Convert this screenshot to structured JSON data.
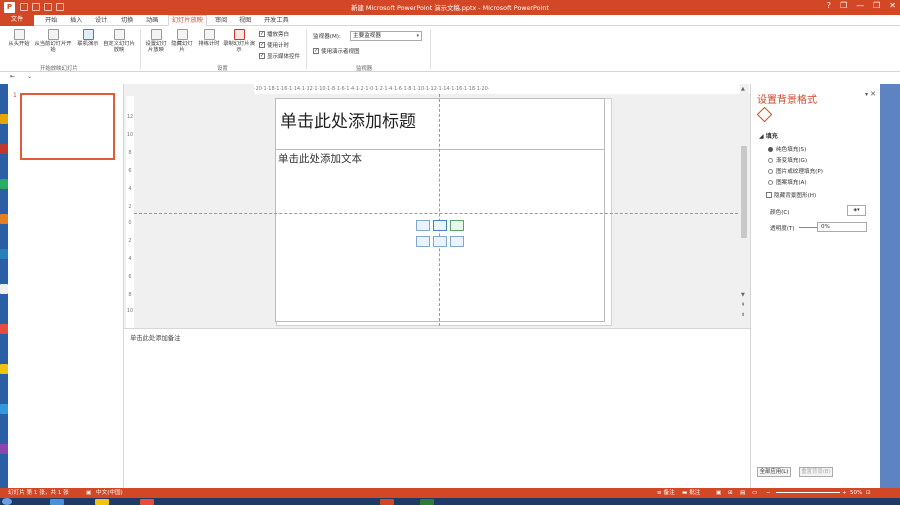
{
  "window": {
    "title": "新建 Microsoft PowerPoint 演示文稿.pptx - Microsoft PowerPoint",
    "help": "?",
    "minimize": "—",
    "restore": "❐",
    "close": "✕"
  },
  "app_logo": "P",
  "tabs": [
    {
      "label": "文件"
    },
    {
      "label": "开始"
    },
    {
      "label": "插入"
    },
    {
      "label": "设计"
    },
    {
      "label": "切换"
    },
    {
      "label": "动画"
    },
    {
      "label": "幻灯片放映"
    },
    {
      "label": "审阅"
    },
    {
      "label": "视图"
    },
    {
      "label": "开发工具"
    }
  ],
  "ribbon": {
    "from_start": "从头开始",
    "from_current": "从当前幻灯片开始",
    "online": "联机演示",
    "custom": "自定义幻灯片放映",
    "group_start": "开始放映幻灯片",
    "setup": "设置幻灯片放映",
    "hide": "隐藏幻灯片",
    "rehearse": "排练计时",
    "record": "录制幻灯片演示",
    "chk_narration": "播放旁白",
    "chk_timings": "使用计时",
    "chk_media": "显示媒体控件",
    "group_setup": "设置",
    "monitor_label": "监视器(M):",
    "monitor_value": "主要监视器",
    "presenter_view": "使用演示者视图",
    "group_monitor": "监视器"
  },
  "slides_panel": {
    "slide_number": "1"
  },
  "slide": {
    "title_placeholder": "单击此处添加标题",
    "body_placeholder": "单击此处添加文本"
  },
  "ruler": {
    "horizontal": "·20·1·18·1·16·1·14·1·12·1·10·1·8·1·6·1·4·1·2·1·0·1·2·1·4·1·6·1·8·1·10·1·12·1·14·1·16·1·18·1·20·",
    "vertical": [
      "12",
      "10",
      "8",
      "6",
      "4",
      "2",
      "0",
      "2",
      "4",
      "6",
      "8",
      "10",
      "12"
    ]
  },
  "notes": {
    "placeholder": "单击此处添加备注"
  },
  "format_pane": {
    "title": "设置背景格式",
    "section": "填充",
    "options": [
      {
        "label": "纯色填充(S)",
        "selected": true
      },
      {
        "label": "渐变填充(G)",
        "selected": false
      },
      {
        "label": "图片或纹理填充(P)",
        "selected": false
      },
      {
        "label": "图案填充(A)",
        "selected": false
      }
    ],
    "hide_bg": "隐藏背景图形(H)",
    "color_label": "颜色(C)",
    "transparency_label": "透明度(T)",
    "transparency_value": "0%",
    "apply_all": "全部应用(L)",
    "reset": "重置背景(B)"
  },
  "status": {
    "slide_info": "幻灯片 第 1 张，共 1 张",
    "language": "中文(中国)",
    "notes_btn": "备注",
    "comments_btn": "批注",
    "zoom": "50%"
  }
}
